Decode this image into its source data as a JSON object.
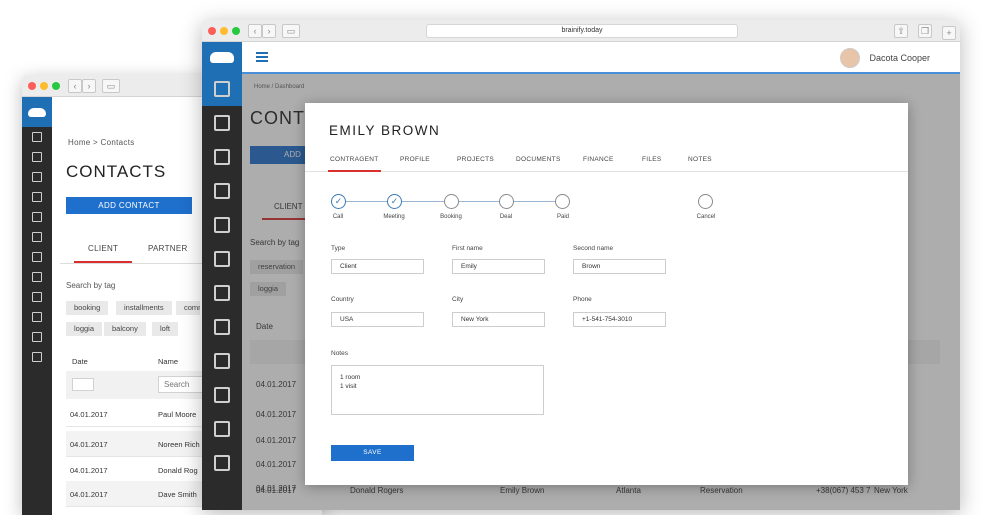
{
  "back_window": {
    "breadcrumb": "Home > Contacts",
    "page_title": "CONTACTS",
    "add_contact_label": "ADD CONTACT",
    "tabs": [
      {
        "label": "CLIENT",
        "active": true
      },
      {
        "label": "PARTNER",
        "active": false
      }
    ],
    "search_by_tag_label": "Search by tag",
    "tags_row1": [
      "booking",
      "installments",
      "comm"
    ],
    "tags_row2": [
      "loggia",
      "balcony",
      "loft"
    ],
    "columns": [
      "Date",
      "Name"
    ],
    "search_placeholder": "Search",
    "rows": [
      {
        "date": "04.01.2017",
        "name": "Paul Moore"
      },
      {
        "date": "04.01.2017",
        "name": "Noreen Rich"
      },
      {
        "date": "04.01.2017",
        "name": "Donald Rog"
      },
      {
        "date": "04.01.2017",
        "name": "Dave Smith"
      }
    ]
  },
  "front_window": {
    "url": "brainify.today",
    "user_name": "Dacota Cooper",
    "breadcrumb": "Home  /  Dashboard",
    "page_title_partial": "CONT",
    "background_partial": {
      "btn": "ADD",
      "tab": "CLIENT",
      "search_by_tag": "Search by tag",
      "tags": [
        "reservation",
        "loggia"
      ],
      "date_header": "Date",
      "dates": [
        "04.01.2017",
        "04.01.2017",
        "04.01.2017",
        "04.01.2017",
        "04.01.2017",
        "04.01.2017"
      ],
      "last_row": {
        "name": "Donald Rogers",
        "person": "Emily  Brown",
        "city": "Atlanta",
        "status": "Reservation",
        "phone": "+38(067) 453 787 2",
        "location": "New York"
      }
    }
  },
  "modal": {
    "title": "EMILY  BROWN",
    "tabs": [
      "CONTRAGENT",
      "PROFILE",
      "PROJECTS",
      "DOCUMENTS",
      "FINANCE",
      "FILES",
      "NOTES"
    ],
    "active_tab": "CONTRAGENT",
    "steps": [
      {
        "label": "Call",
        "done": true
      },
      {
        "label": "Meeting",
        "done": true
      },
      {
        "label": "Booking",
        "done": false
      },
      {
        "label": "Deal",
        "done": false
      },
      {
        "label": "Paid",
        "done": false
      },
      {
        "label": "Cancel",
        "done": false
      }
    ],
    "fields": {
      "type": {
        "label": "Type",
        "value": "Client"
      },
      "first_name": {
        "label": "First name",
        "value": "Emily"
      },
      "second_name": {
        "label": "Second name",
        "value": "Brown"
      },
      "country": {
        "label": "Country",
        "value": "USA"
      },
      "city": {
        "label": "City",
        "value": "New York"
      },
      "phone": {
        "label": "Phone",
        "value": "+1-541-754-3010"
      }
    },
    "notes_label": "Notes",
    "notes_lines": [
      "1 room",
      "1 visit"
    ],
    "save_label": "SAVE"
  },
  "colors": {
    "accent": "#1f6fcc",
    "active_tab": "#d9302f",
    "sidebar": "#2b2b2b"
  }
}
